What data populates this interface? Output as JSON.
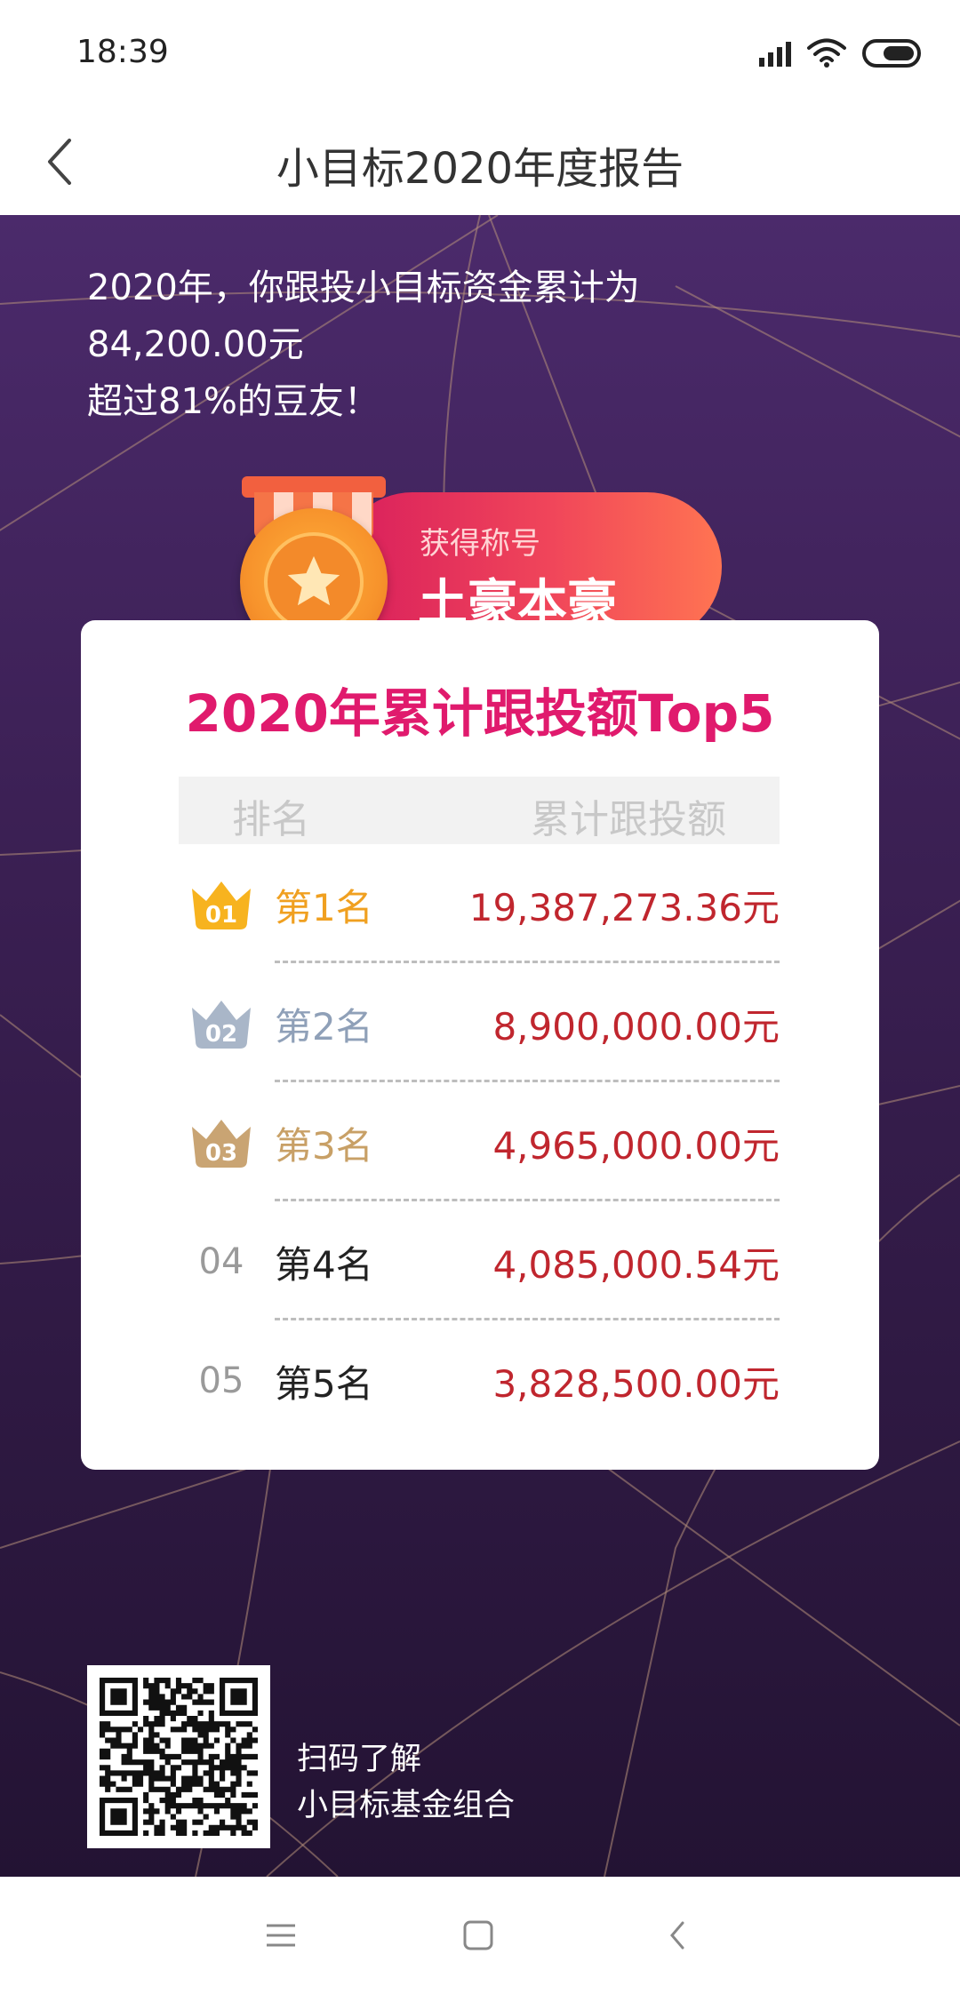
{
  "status_bar": {
    "time": "18:39"
  },
  "header": {
    "title": "小目标2020年度报告"
  },
  "summary": {
    "line1": "2020年，你跟投小目标资金累计为",
    "line2": "84,200.00元",
    "line3": "超过81%的豆友！"
  },
  "badge": {
    "caption": "获得称号",
    "title": "土豪本豪"
  },
  "ranking": {
    "title": "2020年累计跟投额Top5",
    "header_rank": "排名",
    "header_amount": "累计跟投额",
    "rows": [
      {
        "num": "01",
        "label": "第1名",
        "amount": "19,387,273.36元",
        "label_color": "#f0a020"
      },
      {
        "num": "02",
        "label": "第2名",
        "amount": "8,900,000.00元",
        "label_color": "#8fa0b8"
      },
      {
        "num": "03",
        "label": "第3名",
        "amount": "4,965,000.00元",
        "label_color": "#c8a066"
      },
      {
        "num": "04",
        "label": "第4名",
        "amount": "4,085,000.54元",
        "label_color": "#222222"
      },
      {
        "num": "05",
        "label": "第5名",
        "amount": "3,828,500.00元",
        "label_color": "#222222"
      }
    ]
  },
  "qr": {
    "line1": "扫码了解",
    "line2": "小目标基金组合"
  },
  "colors": {
    "accent": "#e01a6d",
    "amount": "#c0262e",
    "background_top": "#4b2a6b",
    "background_bottom": "#231333",
    "gold_crown": "#f7b31f",
    "silver_crown": "#a9b6c8",
    "bronze_crown": "#c9a473"
  },
  "icons": {
    "back": "chevron-left-icon",
    "signal": "signal-icon",
    "wifi": "wifi-icon",
    "battery": "battery-icon",
    "medal": "star-medal-icon",
    "crowns": [
      "gold-crown-icon",
      "silver-crown-icon",
      "bronze-crown-icon"
    ],
    "nav": [
      "menu-icon",
      "home-icon",
      "back-icon"
    ]
  }
}
